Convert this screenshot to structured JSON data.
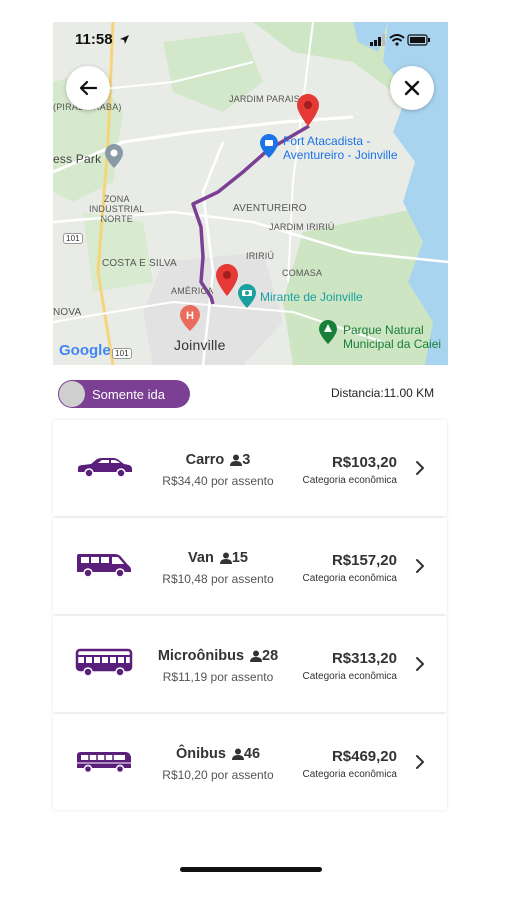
{
  "status_bar": {
    "time": "11:58"
  },
  "map": {
    "labels": {
      "pirabeiraba": "(PIRABEIRABA)",
      "jardim_paraiso": "JARDIM PARAISO",
      "ess_park": "ess Park",
      "zona_industrial": "ZONA\nINDUSTRIAL\nNORTE",
      "aventureiro": "AVENTUREIRO",
      "jardim_iririu": "JARDIM IRIRIÚ",
      "iririu": "IRIRIÚ",
      "costa_e_silva": "COSTA E SILVA",
      "comasa": "COMASA",
      "america": "AMÉRICA",
      "nova": "NOVA",
      "joinville": "Joinville",
      "road_101_a": "101",
      "road_101_b": "101",
      "google": "Google"
    },
    "pois": {
      "fort_atacadista": "Fort Atacadista -\nAventureiro - Joinville",
      "mirante": "Mirante de Joinville",
      "parque": "Parque Natural\nMunicipal da Caiei"
    },
    "colors": {
      "route": "#7b3f94",
      "pin": "#e53935",
      "poi_blue": "#1a73e8",
      "poi_teal": "#1aa0a0",
      "poi_green": "#188038"
    }
  },
  "trip": {
    "toggle_label": "Somente ida",
    "distance": "Distancia:11.00 KM"
  },
  "vehicles": [
    {
      "name": "Carro",
      "seats": "3",
      "seat_price": "R$34,40 por assento",
      "price": "R$103,20",
      "category": "Categoria econômica",
      "icon": "car-icon"
    },
    {
      "name": "Van",
      "seats": "15",
      "seat_price": "R$10,48 por assento",
      "price": "R$157,20",
      "category": "Categoria econômica",
      "icon": "van-icon"
    },
    {
      "name": "Microônibus",
      "seats": "28",
      "seat_price": "R$11,19 por assento",
      "price": "R$313,20",
      "category": "Categoria econômica",
      "icon": "minibus-icon"
    },
    {
      "name": "Ônibus",
      "seats": "46",
      "seat_price": "R$10,20 por assento",
      "price": "R$469,20",
      "category": "Categoria econômica",
      "icon": "bus-icon"
    }
  ],
  "theme": {
    "accent": "#7b3f94",
    "text": "#333333"
  }
}
